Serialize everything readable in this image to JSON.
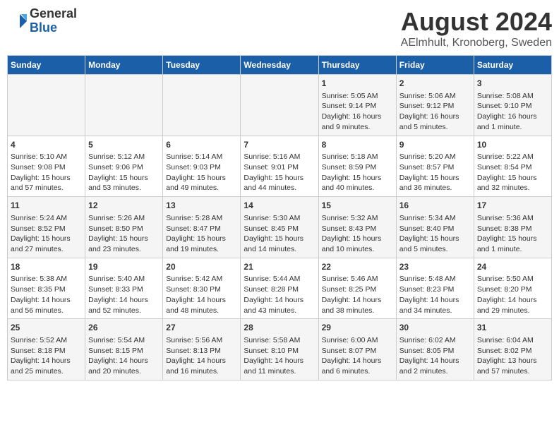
{
  "logo": {
    "general": "General",
    "blue": "Blue"
  },
  "title": "August 2024",
  "subtitle": "AElmhult, Kronoberg, Sweden",
  "days": [
    "Sunday",
    "Monday",
    "Tuesday",
    "Wednesday",
    "Thursday",
    "Friday",
    "Saturday"
  ],
  "weeks": [
    [
      {
        "date": "",
        "info": ""
      },
      {
        "date": "",
        "info": ""
      },
      {
        "date": "",
        "info": ""
      },
      {
        "date": "",
        "info": ""
      },
      {
        "date": "1",
        "info": "Sunrise: 5:05 AM\nSunset: 9:14 PM\nDaylight: 16 hours\nand 9 minutes."
      },
      {
        "date": "2",
        "info": "Sunrise: 5:06 AM\nSunset: 9:12 PM\nDaylight: 16 hours\nand 5 minutes."
      },
      {
        "date": "3",
        "info": "Sunrise: 5:08 AM\nSunset: 9:10 PM\nDaylight: 16 hours\nand 1 minute."
      }
    ],
    [
      {
        "date": "4",
        "info": "Sunrise: 5:10 AM\nSunset: 9:08 PM\nDaylight: 15 hours\nand 57 minutes."
      },
      {
        "date": "5",
        "info": "Sunrise: 5:12 AM\nSunset: 9:06 PM\nDaylight: 15 hours\nand 53 minutes."
      },
      {
        "date": "6",
        "info": "Sunrise: 5:14 AM\nSunset: 9:03 PM\nDaylight: 15 hours\nand 49 minutes."
      },
      {
        "date": "7",
        "info": "Sunrise: 5:16 AM\nSunset: 9:01 PM\nDaylight: 15 hours\nand 44 minutes."
      },
      {
        "date": "8",
        "info": "Sunrise: 5:18 AM\nSunset: 8:59 PM\nDaylight: 15 hours\nand 40 minutes."
      },
      {
        "date": "9",
        "info": "Sunrise: 5:20 AM\nSunset: 8:57 PM\nDaylight: 15 hours\nand 36 minutes."
      },
      {
        "date": "10",
        "info": "Sunrise: 5:22 AM\nSunset: 8:54 PM\nDaylight: 15 hours\nand 32 minutes."
      }
    ],
    [
      {
        "date": "11",
        "info": "Sunrise: 5:24 AM\nSunset: 8:52 PM\nDaylight: 15 hours\nand 27 minutes."
      },
      {
        "date": "12",
        "info": "Sunrise: 5:26 AM\nSunset: 8:50 PM\nDaylight: 15 hours\nand 23 minutes."
      },
      {
        "date": "13",
        "info": "Sunrise: 5:28 AM\nSunset: 8:47 PM\nDaylight: 15 hours\nand 19 minutes."
      },
      {
        "date": "14",
        "info": "Sunrise: 5:30 AM\nSunset: 8:45 PM\nDaylight: 15 hours\nand 14 minutes."
      },
      {
        "date": "15",
        "info": "Sunrise: 5:32 AM\nSunset: 8:43 PM\nDaylight: 15 hours\nand 10 minutes."
      },
      {
        "date": "16",
        "info": "Sunrise: 5:34 AM\nSunset: 8:40 PM\nDaylight: 15 hours\nand 5 minutes."
      },
      {
        "date": "17",
        "info": "Sunrise: 5:36 AM\nSunset: 8:38 PM\nDaylight: 15 hours\nand 1 minute."
      }
    ],
    [
      {
        "date": "18",
        "info": "Sunrise: 5:38 AM\nSunset: 8:35 PM\nDaylight: 14 hours\nand 56 minutes."
      },
      {
        "date": "19",
        "info": "Sunrise: 5:40 AM\nSunset: 8:33 PM\nDaylight: 14 hours\nand 52 minutes."
      },
      {
        "date": "20",
        "info": "Sunrise: 5:42 AM\nSunset: 8:30 PM\nDaylight: 14 hours\nand 48 minutes."
      },
      {
        "date": "21",
        "info": "Sunrise: 5:44 AM\nSunset: 8:28 PM\nDaylight: 14 hours\nand 43 minutes."
      },
      {
        "date": "22",
        "info": "Sunrise: 5:46 AM\nSunset: 8:25 PM\nDaylight: 14 hours\nand 38 minutes."
      },
      {
        "date": "23",
        "info": "Sunrise: 5:48 AM\nSunset: 8:23 PM\nDaylight: 14 hours\nand 34 minutes."
      },
      {
        "date": "24",
        "info": "Sunrise: 5:50 AM\nSunset: 8:20 PM\nDaylight: 14 hours\nand 29 minutes."
      }
    ],
    [
      {
        "date": "25",
        "info": "Sunrise: 5:52 AM\nSunset: 8:18 PM\nDaylight: 14 hours\nand 25 minutes."
      },
      {
        "date": "26",
        "info": "Sunrise: 5:54 AM\nSunset: 8:15 PM\nDaylight: 14 hours\nand 20 minutes."
      },
      {
        "date": "27",
        "info": "Sunrise: 5:56 AM\nSunset: 8:13 PM\nDaylight: 14 hours\nand 16 minutes."
      },
      {
        "date": "28",
        "info": "Sunrise: 5:58 AM\nSunset: 8:10 PM\nDaylight: 14 hours\nand 11 minutes."
      },
      {
        "date": "29",
        "info": "Sunrise: 6:00 AM\nSunset: 8:07 PM\nDaylight: 14 hours\nand 6 minutes."
      },
      {
        "date": "30",
        "info": "Sunrise: 6:02 AM\nSunset: 8:05 PM\nDaylight: 14 hours\nand 2 minutes."
      },
      {
        "date": "31",
        "info": "Sunrise: 6:04 AM\nSunset: 8:02 PM\nDaylight: 13 hours\nand 57 minutes."
      }
    ]
  ]
}
